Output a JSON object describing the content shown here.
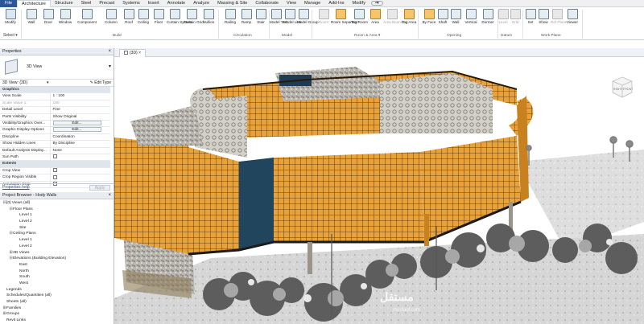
{
  "ribbon_tabs": [
    "File",
    "Architecture",
    "Structure",
    "Steel",
    "Precast",
    "Systems",
    "Insert",
    "Annotate",
    "Analyze",
    "Massing & Site",
    "Collaborate",
    "View",
    "Manage",
    "Add-Ins",
    "Modify"
  ],
  "active_tab": "Architecture",
  "ribbon": {
    "modify": "Modify",
    "select": "Select ▾",
    "build": {
      "group": "Build",
      "items": [
        "Wall",
        "Door",
        "Window",
        "Component",
        "Column",
        "Roof",
        "Ceiling",
        "Floor",
        "Curtain System",
        "Curtain Grid",
        "Mullion"
      ]
    },
    "circulation": {
      "group": "Circulation",
      "items": [
        "Railing",
        "Ramp",
        "Stair"
      ]
    },
    "model": {
      "group": "Model",
      "items": [
        "Model Text",
        "Model Line",
        "Model Group"
      ]
    },
    "room_area": {
      "group": "Room & Area ▾",
      "items": [
        "Room",
        "Room Separator",
        "Tag Room",
        "Area",
        "Area Boundary",
        "Tag Area"
      ]
    },
    "opening": {
      "group": "Opening",
      "items": [
        "By Face",
        "Shaft",
        "Wall",
        "Vertical",
        "Dormer"
      ]
    },
    "datum": {
      "group": "Datum",
      "items": [
        "Level",
        "Grid"
      ]
    },
    "work_plane": {
      "group": "Work Plane",
      "items": [
        "Set",
        "Show",
        "Ref Plane",
        "Viewer"
      ]
    }
  },
  "properties": {
    "title": "Properties",
    "type_name": "3D View",
    "selector": "3D View: {3D}",
    "edit_type": "Edit Type",
    "sections": [
      {
        "header": "Graphics",
        "rows": [
          {
            "k": "View Scale",
            "v": "1 : 100"
          },
          {
            "k": "Scale Value    1:",
            "v": "100",
            "dis": true
          },
          {
            "k": "Detail Level",
            "v": "Fine"
          },
          {
            "k": "Parts Visibility",
            "v": "Show Original"
          },
          {
            "k": "Visibility/Graphics Over...",
            "v": "Edit...",
            "btn": true
          },
          {
            "k": "Graphic Display Options",
            "v": "Edit...",
            "btn": true
          },
          {
            "k": "Discipline",
            "v": "Coordination"
          },
          {
            "k": "Show Hidden Lines",
            "v": "By Discipline"
          },
          {
            "k": "Default Analysis Display...",
            "v": "None"
          },
          {
            "k": "Sun Path",
            "v": "",
            "chk": true
          }
        ]
      },
      {
        "header": "Extents",
        "rows": [
          {
            "k": "Crop View",
            "v": "",
            "chk": true
          },
          {
            "k": "Crop Region Visible",
            "v": "",
            "chk": true
          },
          {
            "k": "Annotation Crop",
            "v": "",
            "chk": true
          }
        ]
      }
    ],
    "help": "Properties help",
    "apply": "Apply"
  },
  "browser": {
    "title": "Project Browser - Hody Walls",
    "tree": [
      {
        "d": 0,
        "t": "⊟",
        "label": "[0] Views (all)"
      },
      {
        "d": 1,
        "t": "⊟",
        "label": "Floor Plans"
      },
      {
        "d": 2,
        "t": "",
        "label": "Level 1"
      },
      {
        "d": 2,
        "t": "",
        "label": "Level 2"
      },
      {
        "d": 2,
        "t": "",
        "label": "Site"
      },
      {
        "d": 1,
        "t": "⊟",
        "label": "Ceiling Plans"
      },
      {
        "d": 2,
        "t": "",
        "label": "Level 1"
      },
      {
        "d": 2,
        "t": "",
        "label": "Level 2"
      },
      {
        "d": 1,
        "t": "⊞",
        "label": "3D Views"
      },
      {
        "d": 1,
        "t": "⊟",
        "label": "Elevations (Building Elevation)"
      },
      {
        "d": 2,
        "t": "",
        "label": "East"
      },
      {
        "d": 2,
        "t": "",
        "label": "North"
      },
      {
        "d": 2,
        "t": "",
        "label": "South"
      },
      {
        "d": 2,
        "t": "",
        "label": "West"
      },
      {
        "d": 0,
        "t": "",
        "label": "Legends"
      },
      {
        "d": 0,
        "t": "",
        "label": "Schedules/Quantities (all)"
      },
      {
        "d": 0,
        "t": "",
        "label": "Sheets (all)"
      },
      {
        "d": 0,
        "t": "⊞",
        "label": "Families"
      },
      {
        "d": 0,
        "t": "⊞",
        "label": "Groups"
      },
      {
        "d": 0,
        "t": "",
        "label": "Revit Links"
      }
    ]
  },
  "view_tab": "(3D)",
  "viewcube": {
    "front": "FRONT",
    "right": "RIGHT"
  },
  "watermark": {
    "brand": "مستقل",
    "url": "mostaql.com"
  },
  "colors": {
    "accent": "#2b579a",
    "facade": "#e9a13a",
    "glass": "#22455e"
  }
}
